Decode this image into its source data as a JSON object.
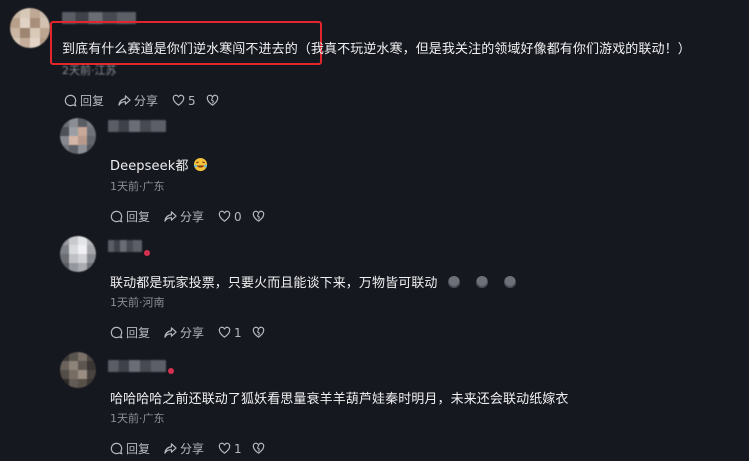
{
  "comments": [
    {
      "text": "到底有什么赛道是你们逆水寒闯不进去的（我真不玩逆水寒，但是我关注的领域好像都有你们游戏的联动！）",
      "meta": "2天前·江苏",
      "reply_label": "回复",
      "share_label": "分享",
      "like_count": "5"
    },
    {
      "text": "Deepseek都",
      "emoji": "rofl-emoji",
      "meta": "1天前·广东",
      "reply_label": "回复",
      "share_label": "分享",
      "like_count": "0"
    },
    {
      "text": "联动都是玩家投票，只要火而且能谈下来，万物皆可联动",
      "emoji": "dizzy-face-emoji",
      "meta": "1天前·河南",
      "reply_label": "回复",
      "share_label": "分享",
      "like_count": "1"
    },
    {
      "text": "哈哈哈哈之前还联动了狐妖看思量衰羊羊葫芦娃秦时明月，未来还会联动纸嫁衣",
      "meta": "1天前·广东",
      "reply_label": "回复",
      "share_label": "分享",
      "like_count": "1"
    }
  ],
  "colors": {
    "background": "#16181f",
    "highlight": "#e3262c",
    "muted": "#8d8f97"
  }
}
